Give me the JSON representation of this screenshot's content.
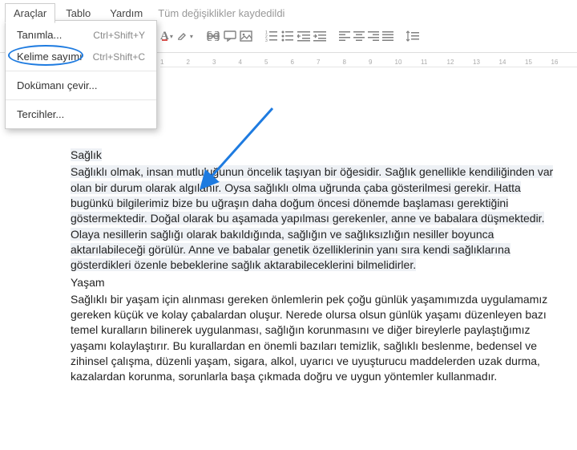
{
  "menubar": {
    "items": [
      "Araçlar",
      "Tablo",
      "Yardım"
    ],
    "save_status": "Tüm değişiklikler kaydedildi"
  },
  "dropdown": {
    "define": {
      "label": "Tanımla...",
      "shortcut": "Ctrl+Shift+Y"
    },
    "wordcount": {
      "label": "Kelime sayımı",
      "shortcut": "Ctrl+Shift+C"
    },
    "translate": {
      "label": "Dokümanı çevir..."
    },
    "prefs": {
      "label": "Tercihler..."
    }
  },
  "ruler": {
    "marks": [
      "1",
      "2",
      "3",
      "4",
      "5",
      "6",
      "7",
      "8",
      "9",
      "10",
      "11",
      "12",
      "13",
      "14",
      "15",
      "16"
    ]
  },
  "doc": {
    "title1": "Sağlık",
    "para1": "Sağlıklı olmak, insan mutluluğunun öncelik taşıyan bir öğesidir. Sağlık genellikle kendiliğinden var olan bir durum olarak algılanır. Oysa sağlıklı olma uğrunda çaba gösterilmesi gerekir. Hatta bugünkü bilgilerimiz bize bu uğraşın daha doğum öncesi dönemde başlaması gerektiğini göstermektedir. Doğal olarak bu aşamada yapılması gerekenler, anne ve babalara düşmektedir. Olaya nesillerin sağlığı olarak bakıldığında, sağlığın ve sağlıksızlığın nesiller boyunca aktarılabileceği görülür. Anne ve babalar genetik özelliklerinin yanı sıra kendi sağlıklarına gösterdikleri özenle bebeklerine sağlık aktarabileceklerini bilmelidirler.",
    "title2": "Yaşam",
    "para2": "Sağlıklı bir yaşam için alınması gereken önlemlerin pek çoğu günlük yaşamımızda  uygulamamız gereken küçük ve kolay çabalardan oluşur. Nerede olursa olsun günlük yaşamı düzenleyen bazı temel kuralların bilinerek uygulanması, sağlığın korunmasını ve diğer bireylerle paylaştığımız yaşamı kolaylaştırır. Bu kurallardan en önemli bazıları temizlik, sağlıklı beslenme, bedensel ve zihinsel çalışma, düzenli yaşam, sigara, alkol, uyarıcı ve uyuşturucu maddelerden uzak durma, kazalardan korunma, sorunlarla başa çıkmada doğru ve uygun yöntemler kullanmadır."
  }
}
